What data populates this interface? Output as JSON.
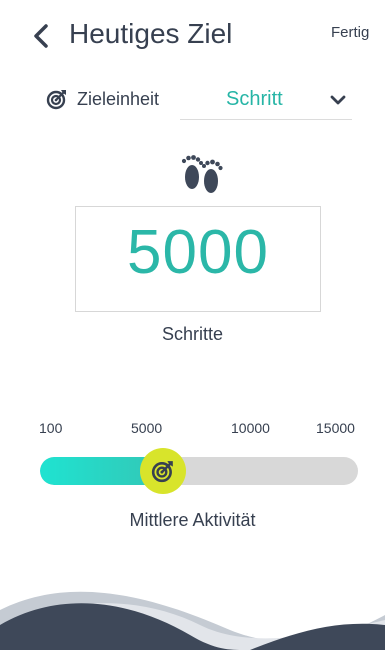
{
  "header": {
    "title": "Heutiges Ziel",
    "done_label": "Fertig"
  },
  "unit_row": {
    "label": "Zieleinheit",
    "selected_value": "Schritt"
  },
  "goal": {
    "value": "5000",
    "unit_label": "Schritte"
  },
  "slider": {
    "ticks": [
      "100",
      "5000",
      "10000",
      "15000"
    ],
    "min": 100,
    "max": 15000,
    "value": 5000,
    "level_label": "Mittlere Aktivität"
  },
  "icons": {
    "back": "chevron-left-icon",
    "target": "target-icon",
    "dropdown": "chevron-down-icon",
    "feet": "footprints-icon"
  },
  "colors": {
    "accent": "#2bb7a8",
    "slider_fill_start": "#1fe3d1",
    "slider_fill_end": "#33c7b6",
    "thumb": "#d8e42b",
    "text": "#374050",
    "wave_dark": "#3e4859",
    "wave_light": "#c5cbd3"
  }
}
